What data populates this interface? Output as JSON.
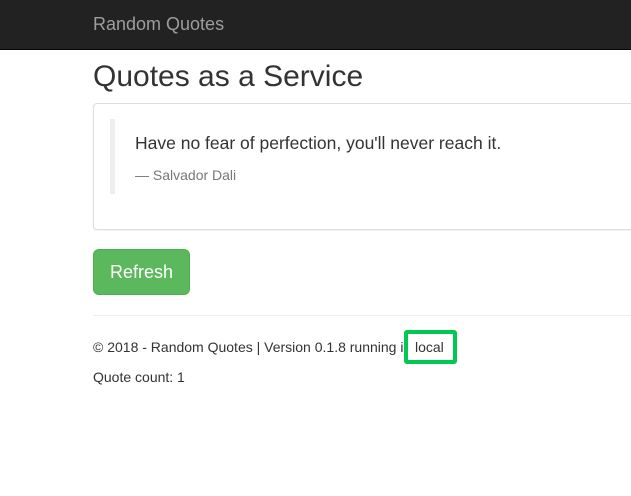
{
  "navbar": {
    "brand": "Random Quotes"
  },
  "page": {
    "title": "Quotes as a Service"
  },
  "quote": {
    "text": "Have no fear of perfection, you'll never reach it.",
    "author": "— Salvador Dali"
  },
  "actions": {
    "refresh_label": "Refresh"
  },
  "footer": {
    "info": "© 2018 - Random Quotes | Version 0.1.8 running i",
    "environment": "local",
    "quote_count": "Quote count: 1"
  },
  "colors": {
    "navbar_bg": "#222222",
    "brand_text": "#9d9d9d",
    "button_success": "#5cb85c",
    "highlight_border": "#00c853"
  }
}
